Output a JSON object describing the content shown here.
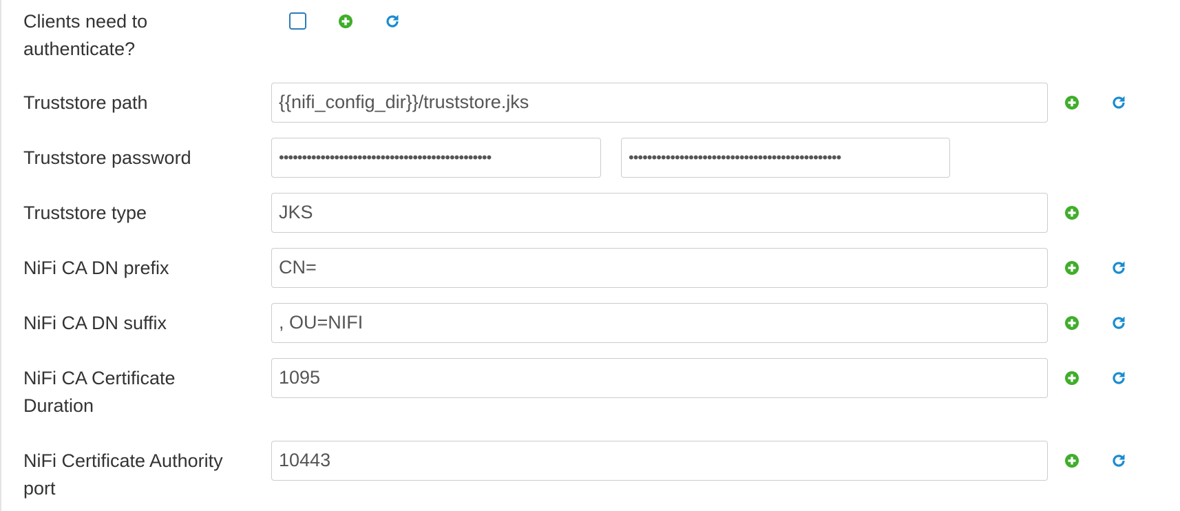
{
  "colors": {
    "add_icon": "#3fae2a",
    "refresh_icon": "#1a8ccf",
    "checkbox_border": "#2a7bb8",
    "input_border": "#cccccc",
    "label_text": "#333333"
  },
  "icons": {
    "add": "plus-circle-icon",
    "refresh": "refresh-icon"
  },
  "fields": {
    "clients_auth": {
      "label_line1": "Clients need to",
      "label_line2": "authenticate?",
      "checked": false
    },
    "truststore_path": {
      "label": "Truststore path",
      "value": "{{nifi_config_dir}}/truststore.jks"
    },
    "truststore_password": {
      "label": "Truststore password",
      "value": "••••••••••••••••••••••••••••••••••••••••••••••",
      "confirm_value": "••••••••••••••••••••••••••••••••••••••••••••••"
    },
    "truststore_type": {
      "label": "Truststore type",
      "value": "JKS"
    },
    "ca_dn_prefix": {
      "label": "NiFi CA DN prefix",
      "value": "CN="
    },
    "ca_dn_suffix": {
      "label": "NiFi CA DN suffix",
      "value": ", OU=NIFI"
    },
    "ca_cert_duration": {
      "label_line1": "NiFi CA Certificate",
      "label_line2": "Duration",
      "value": "1095"
    },
    "ca_port": {
      "label_line1": "NiFi Certificate Authority",
      "label_line2": "port",
      "value": "10443"
    }
  }
}
